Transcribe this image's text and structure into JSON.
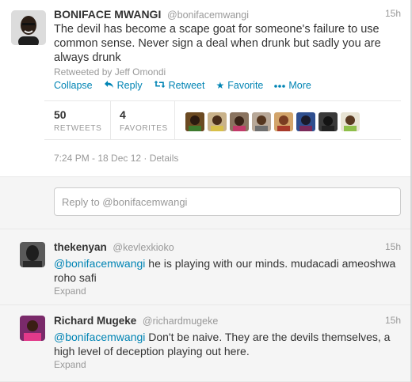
{
  "main_tweet": {
    "fullname": "BONIFACE MWANGI",
    "handle": "@bonifacemwangi",
    "time": "15h",
    "text": "The devil has become a scape goat for someone's failure to use common sense. Never sign a deal when drunk but sadly you are always drunk",
    "retweeted_by": "Retweeted by Jeff Omondi",
    "actions": {
      "collapse": "Collapse",
      "reply": "Reply",
      "retweet": "Retweet",
      "favorite": "Favorite",
      "more": "More"
    },
    "icons": {
      "reply": "reply-arrow-icon",
      "retweet": "retweet-icon",
      "favorite": "star-icon",
      "more": "dots-icon"
    },
    "stats": {
      "retweets_count": "50",
      "retweets_label": "RETWEETS",
      "favorites_count": "4",
      "favorites_label": "FAVORITES"
    },
    "datetime": "7:24 PM - 18 Dec 12 · Details"
  },
  "reply_box": {
    "placeholder": "Reply to @bonifacemwangi"
  },
  "replies": [
    {
      "fullname": "thekenyan",
      "handle": "@kevlexkioko",
      "time": "15h",
      "mention": "@bonifacemwangi",
      "text": " he is playing with our minds. mudacadi ameoshwa roho safi",
      "expand": "Expand"
    },
    {
      "fullname": "Richard Mugeke",
      "handle": "@richardmugeke",
      "time": "15h",
      "mention": "@bonifacemwangi",
      "text": " Don't be naive. They are the devils themselves, a high level of deception playing out here.",
      "expand": "Expand"
    }
  ],
  "colors": {
    "link": "#0084b4",
    "muted": "#999999",
    "text": "#333333",
    "reply_bg": "#f5f5f5"
  }
}
